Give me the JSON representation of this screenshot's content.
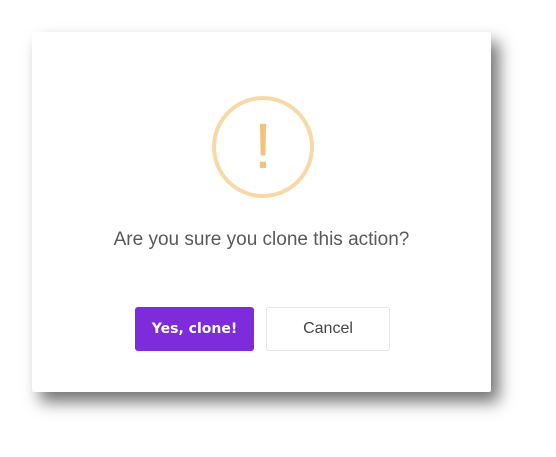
{
  "dialog": {
    "icon": "warning-exclamation-icon",
    "icon_glyph": "!",
    "icon_color": "#f3c37c",
    "icon_ring_color": "#f8d9a6",
    "message": "Are you sure you clone this action?",
    "confirm_label": "Yes, clone!",
    "cancel_label": "Cancel",
    "confirm_color": "#7e2cdb"
  }
}
